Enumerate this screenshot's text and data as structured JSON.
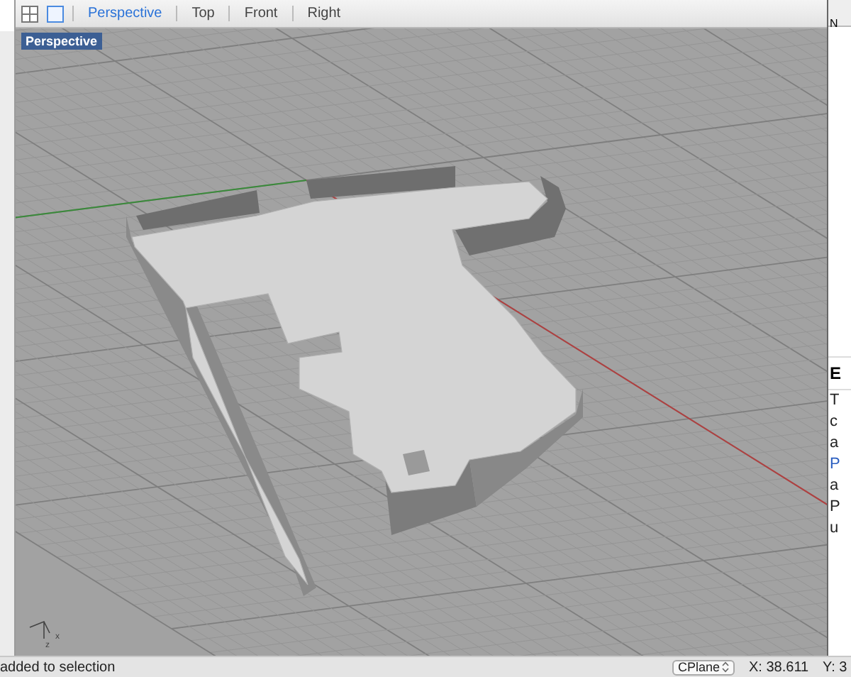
{
  "toolbar": {
    "view_tabs": [
      {
        "label": "Perspective",
        "selected": true
      },
      {
        "label": "Top",
        "selected": false
      },
      {
        "label": "Front",
        "selected": false
      },
      {
        "label": "Right",
        "selected": false
      }
    ]
  },
  "viewport": {
    "title": "Perspective",
    "axis_labels": [
      "z",
      "x"
    ]
  },
  "right_panel": {
    "header": "N",
    "heading": "E",
    "lines": [
      {
        "text": "T",
        "kind": "plain"
      },
      {
        "text": "c",
        "kind": "plain"
      },
      {
        "text": "a",
        "kind": "plain"
      },
      {
        "text": "P",
        "kind": "link"
      },
      {
        "text": "a",
        "kind": "plain"
      },
      {
        "text": "P",
        "kind": "plain"
      },
      {
        "text": "u",
        "kind": "plain"
      }
    ]
  },
  "status_bar": {
    "message": "added to selection",
    "cplane": "CPlane",
    "x": "X: 38.611",
    "y": "Y: 3"
  }
}
